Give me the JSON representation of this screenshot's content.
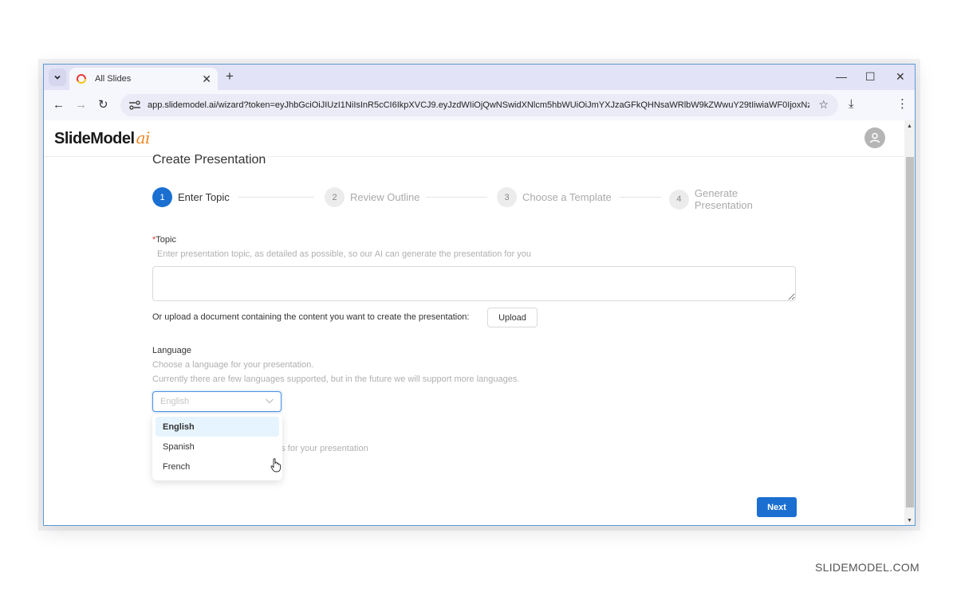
{
  "browser": {
    "tab_title": "All Slides",
    "url": "app.slidemodel.ai/wizard?token=eyJhbGciOiJIUzI1NiIsInR5cCI6IkpXVCJ9.eyJzdWIiOjQwNSwidXNlcm5hbWUiOiJmYXJzaGFkQHNsaWRlbW9kZWwuY29tIiwiaWF0IjoxNz...",
    "icons": {
      "tab_dropdown": "chevron-down-icon",
      "favicon": "slidemodel-favicon",
      "tab_close": "close-icon",
      "new_tab": "plus-icon",
      "minimize": "minimize-icon",
      "maximize": "maximize-icon",
      "close_window": "close-icon",
      "back": "arrow-left-icon",
      "forward": "arrow-right-icon",
      "reload": "reload-icon",
      "site_info": "tune-icon",
      "bookmark": "star-icon",
      "download": "download-icon",
      "menu": "kebab-menu-icon"
    },
    "glyphs": {
      "tab_close": "✕",
      "new_tab": "+",
      "minimize": "—",
      "maximize": "☐",
      "close_window": "✕",
      "back": "←",
      "forward": "→",
      "reload": "↻",
      "star": "☆",
      "download": "⤓",
      "menu": "⋮"
    }
  },
  "app": {
    "logo_text": "SlideModel",
    "logo_suffix": "ai",
    "page_title": "Create Presentation",
    "steps": [
      {
        "number": "1",
        "label": "Enter Topic",
        "active": true
      },
      {
        "number": "2",
        "label": "Review Outline",
        "active": false
      },
      {
        "number": "3",
        "label": "Choose a Template",
        "active": false
      },
      {
        "number": "4",
        "label": "Generate Presentation",
        "active": false
      }
    ],
    "topic": {
      "required_mark": "*",
      "label": "Topic",
      "hint": "Enter presentation topic, as detailed as possible, so our AI can generate the presentation for you",
      "value": ""
    },
    "upload": {
      "text": "Or upload a document containing the content you want to create the presentation:",
      "button_label": "Upload"
    },
    "language": {
      "label": "Language",
      "hint_line1": "Choose a language for your presentation.",
      "hint_line2": "Currently there are few languages supported, but in the future we will support more languages.",
      "placeholder": "English",
      "options": [
        "English",
        "Spanish",
        "French"
      ],
      "selected": "English"
    },
    "slides_hint_partial": "des for your presentation",
    "next_label": "Next",
    "colors": {
      "primary": "#1a6fd1",
      "logo_accent": "#f0841e",
      "required": "#e53935",
      "option_selected_bg": "#e6f4ff"
    }
  },
  "watermark": "SLIDEMODEL.COM"
}
